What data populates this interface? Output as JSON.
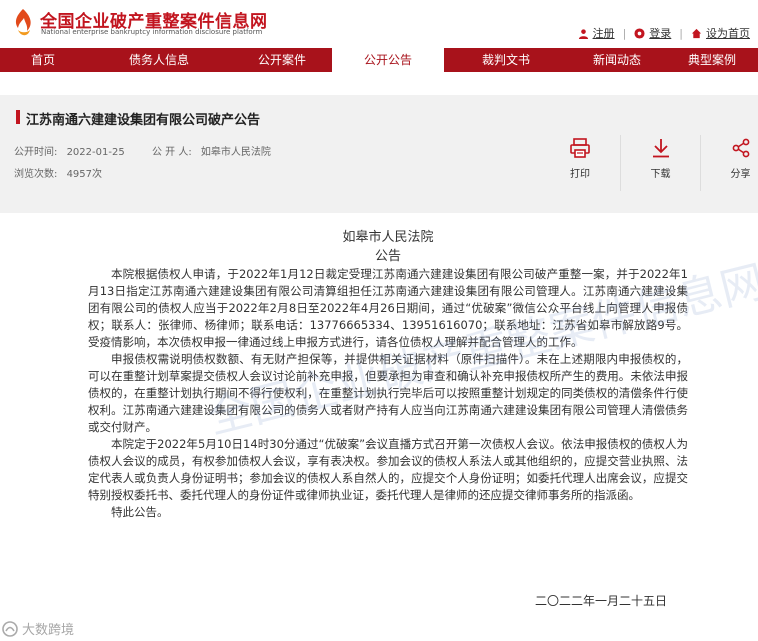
{
  "header": {
    "site_title": "全国企业破产重整案件信息网",
    "site_subtitle": "National enterprise bankruptcy information disclosure platform",
    "links": [
      {
        "label": "注册",
        "icon": "user-icon"
      },
      {
        "label": "登录",
        "icon": "login-icon"
      },
      {
        "label": "设为首页",
        "icon": "home-icon"
      }
    ]
  },
  "nav": {
    "items": [
      "首页",
      "债务人信息",
      "公开案件",
      "公开公告",
      "裁判文书",
      "新闻动态",
      "典型案例"
    ],
    "active_index": 3
  },
  "document": {
    "title": "江苏南通六建建设集团有限公司破产公告",
    "publish_time_label": "公开时间:",
    "publish_time": "2022-01-25",
    "publisher_label": "公 开 人:",
    "publisher": "如皋市人民法院",
    "views_label": "浏览次数:",
    "views": "4957次"
  },
  "actions": [
    {
      "label": "打印",
      "icon": "printer-icon"
    },
    {
      "label": "下载",
      "icon": "download-icon"
    },
    {
      "label": "分享",
      "icon": "share-icon"
    }
  ],
  "body": {
    "court": "如皋市人民法院",
    "notice": "公告",
    "paragraphs": [
      "本院根据债权人申请，于2022年1月12日裁定受理江苏南通六建建设集团有限公司破产重整一案，并于2022年1月13日指定江苏南通六建建设集团有限公司清算组担任江苏南通六建建设集团有限公司管理人。江苏南通六建建设集团有限公司的债权人应当于2022年2月8日至2022年4月26日期间，通过“优破案”微信公众平台线上向管理人申报债权；联系人：张律师、杨律师；联系电话：13776665334、13951616070；联系地址：江苏省如皋市解放路9号。受疫情影响，本次债权申报一律通过线上申报方式进行，请各位债权人理解并配合管理人的工作。",
      "申报债权需说明债权数额、有无财产担保等，并提供相关证据材料（原件扫描件）。未在上述期限内申报债权的，可以在重整计划草案提交债权人会议讨论前补充申报，但要承担为审查和确认补充申报债权所产生的费用。未依法申报债权的，在重整计划执行期间不得行使权利，在重整计划执行完毕后可以按照重整计划规定的同类债权的清偿条件行使权利。江苏南通六建建设集团有限公司的债务人或者财产持有人应当向江苏南通六建建设集团有限公司管理人清偿债务或交付财产。",
      "本院定于2022年5月10日14时30分通过“优破案”会议直播方式召开第一次债权人会议。依法申报债权的债权人为债权人会议的成员，有权参加债权人会议，享有表决权。参加会议的债权人系法人或其他组织的，应提交营业执照、法定代表人或负责人身份证明书；参加会议的债权人系自然人的，应提交个人身份证明；如委托代理人出席会议，应提交特别授权委托书、委托代理人的身份证件或律师执业证，委托代理人是律师的还应提交律师事务所的指派函。",
      "特此公告。"
    ],
    "date": "二〇二二年一月二十五日"
  },
  "overlay": {
    "watermark": "全国企业破产重整案件信息网",
    "brand": "大数跨境"
  },
  "colors": {
    "brand_red": "#a8121b",
    "title_red": "#c2151f",
    "info_bg": "#f1f1f1"
  }
}
